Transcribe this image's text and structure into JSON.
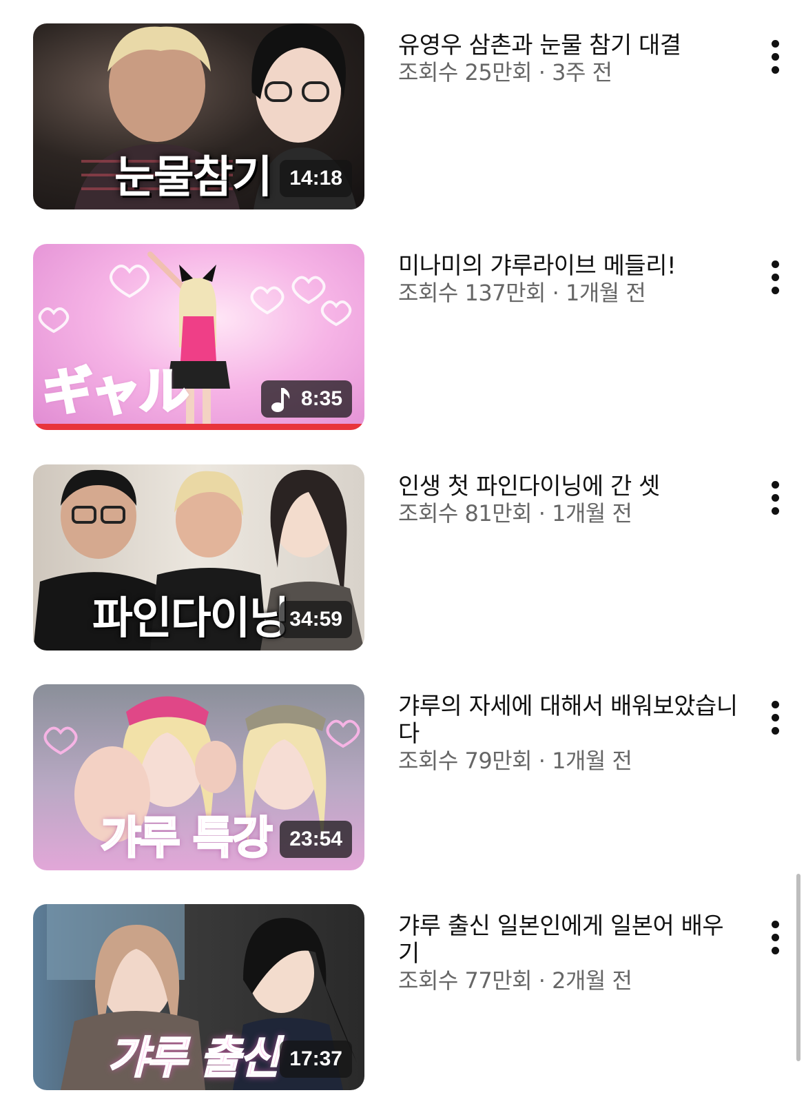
{
  "videos": [
    {
      "title": "유영우 삼촌과 눈물 참기 대결",
      "meta": "조회수 25만회 · 3주 전",
      "duration": "14:18",
      "thumb_caption": "눈물참기",
      "thumb_icon": "",
      "caption_color": "#ffffff"
    },
    {
      "title": "미나미의 갸루라이브 메들리!",
      "meta": "조회수 137만회 · 1개월 전",
      "duration": "8:35",
      "thumb_caption": "ギャル",
      "thumb_icon": "music-note-icon",
      "caption_color": "#ffc1e3",
      "watched_fraction": 1.0
    },
    {
      "title": "인생 첫 파인다이닝에 간 셋",
      "meta": "조회수 81만회 · 1개월 전",
      "duration": "34:59",
      "thumb_caption": "파인다이닝",
      "thumb_icon": "",
      "caption_color": "#ffffff"
    },
    {
      "title": "갸루의 자세에 대해서 배워보았습니다",
      "meta": "조회수 79만회 · 1개월 전",
      "duration": "23:54",
      "thumb_caption": "갸루 특강",
      "thumb_icon": "",
      "caption_color": "#f7a3d8"
    },
    {
      "title": "갸루 출신 일본인에게 일본어 배우기",
      "meta": "조회수 77만회 · 2개월 전",
      "duration": "17:37",
      "thumb_caption": "갸루 출신",
      "thumb_icon": "",
      "caption_color": "#ffd0ef"
    }
  ],
  "colors": {
    "progress": "#e8343b",
    "title_text": "#111111",
    "meta_text": "#666666"
  }
}
